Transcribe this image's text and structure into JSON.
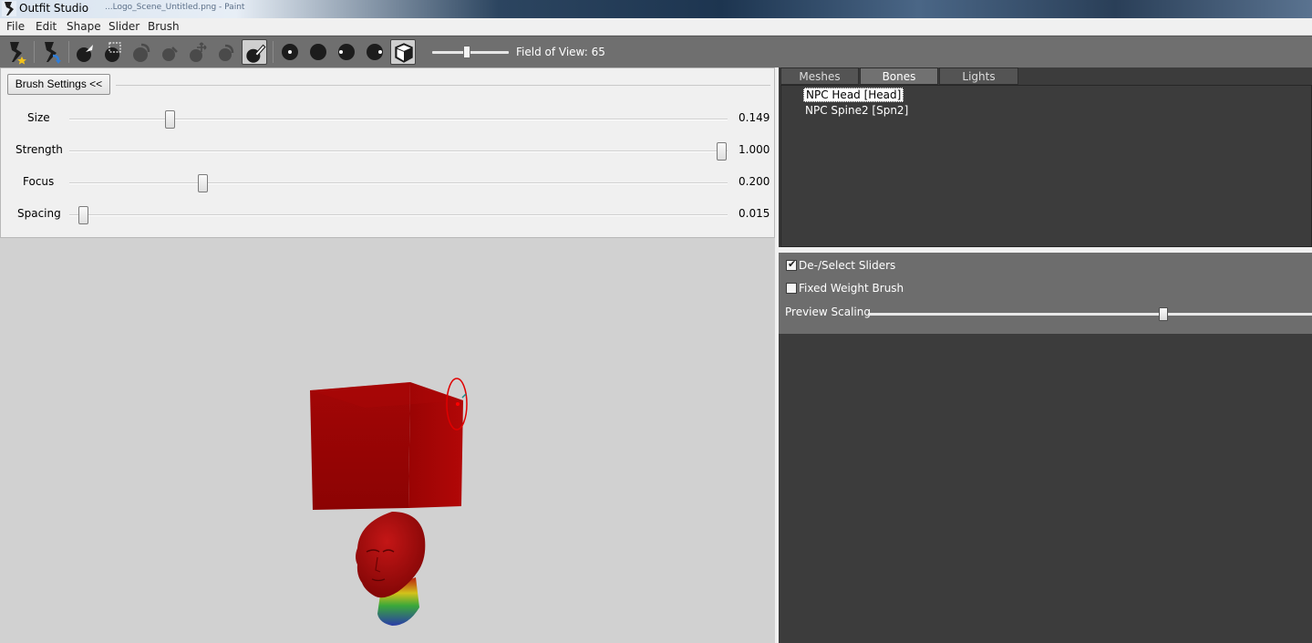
{
  "window": {
    "title": "Outfit Studio",
    "background_text": "...Logo_Scene_Untitled.png - Paint"
  },
  "menu": [
    {
      "name": "file",
      "label": "File"
    },
    {
      "name": "edit",
      "label": "Edit"
    },
    {
      "name": "shape",
      "label": "Shape"
    },
    {
      "name": "slider",
      "label": "Slider"
    },
    {
      "name": "brush",
      "label": "Brush"
    }
  ],
  "toolbar": {
    "field_of_view_label": "Field of View: 65",
    "field_of_view_value": 65,
    "active_tool": "weight-paint-brush"
  },
  "brush_settings": {
    "toggle_label": "Brush Settings <<",
    "rows": [
      {
        "name": "size",
        "label": "Size",
        "value_text": "0.149",
        "value": 0.149
      },
      {
        "name": "strength",
        "label": "Strength",
        "value_text": "1.000",
        "value": 1.0
      },
      {
        "name": "focus",
        "label": "Focus",
        "value_text": "0.200",
        "value": 0.2
      },
      {
        "name": "spacing",
        "label": "Spacing",
        "value_text": "0.015",
        "value": 0.015
      }
    ]
  },
  "tabs": [
    {
      "name": "meshes",
      "label": "Meshes",
      "selected": false
    },
    {
      "name": "bones",
      "label": "Bones",
      "selected": true
    },
    {
      "name": "lights",
      "label": "Lights",
      "selected": false
    }
  ],
  "bones": [
    {
      "label": "NPC Head [Head]",
      "selected": true
    },
    {
      "label": "NPC Spine2 [Spn2]",
      "selected": false
    }
  ],
  "options": {
    "deselect_sliders": {
      "label": "De-/Select Sliders",
      "checked": true
    },
    "fixed_weight_brush": {
      "label": "Fixed Weight Brush",
      "checked": false
    },
    "preview_scaling": {
      "label": "Preview Scaling",
      "value": 0.66
    }
  },
  "colors": {
    "mesh_red": "#a40606",
    "brush_cursor": "#e00000",
    "panel_dark": "#3c3c3c",
    "toolbar": "#6f6f6f"
  }
}
